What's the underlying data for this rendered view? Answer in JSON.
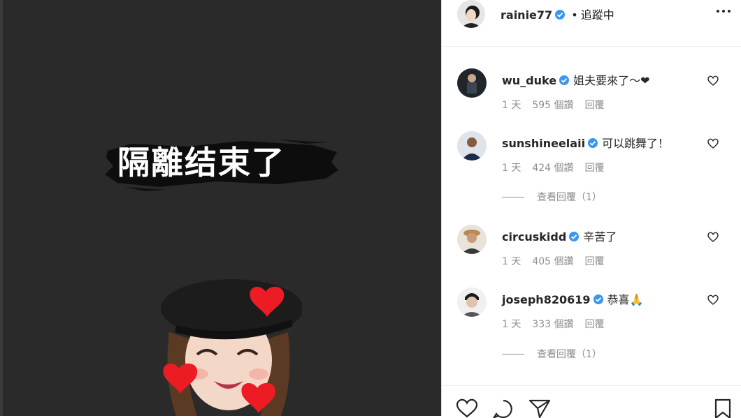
{
  "media": {
    "caption": "隔離结束了",
    "background_color": "#2a2a2a"
  },
  "post_header": {
    "username": "rainie77",
    "verified": true,
    "follow_status": "追蹤中",
    "dot": "•",
    "avatar_icon": "avatar-icon",
    "more_icon": "more-options-icon"
  },
  "comments": [
    {
      "username": "wu_duke",
      "verified": true,
      "text": "姐夫要來了～❤",
      "time": "1 天",
      "likes": "595 個讚",
      "reply_label": "回覆"
    },
    {
      "username": "sunshineelaii",
      "verified": true,
      "text": "可以跳舞了！",
      "time": "1 天",
      "likes": "424 個讚",
      "reply_label": "回覆",
      "view_replies": "查看回覆（1）"
    },
    {
      "username": "circuskidd",
      "verified": true,
      "text": "辛苦了",
      "time": "1 天",
      "likes": "405 個讚",
      "reply_label": "回覆"
    },
    {
      "username": "joseph820619",
      "verified": true,
      "text": "恭喜🙏",
      "time": "1 天",
      "likes": "333 個讚",
      "reply_label": "回覆",
      "view_replies": "查看回覆（1）"
    }
  ],
  "actions": {
    "like_icon": "heart-icon",
    "comment_icon": "comment-icon",
    "share_icon": "share-icon",
    "save_icon": "bookmark-icon"
  },
  "colors": {
    "verified": "#3897f0",
    "text": "#262626",
    "muted": "#8e8e8e",
    "heart_red": "#ed1c24"
  }
}
